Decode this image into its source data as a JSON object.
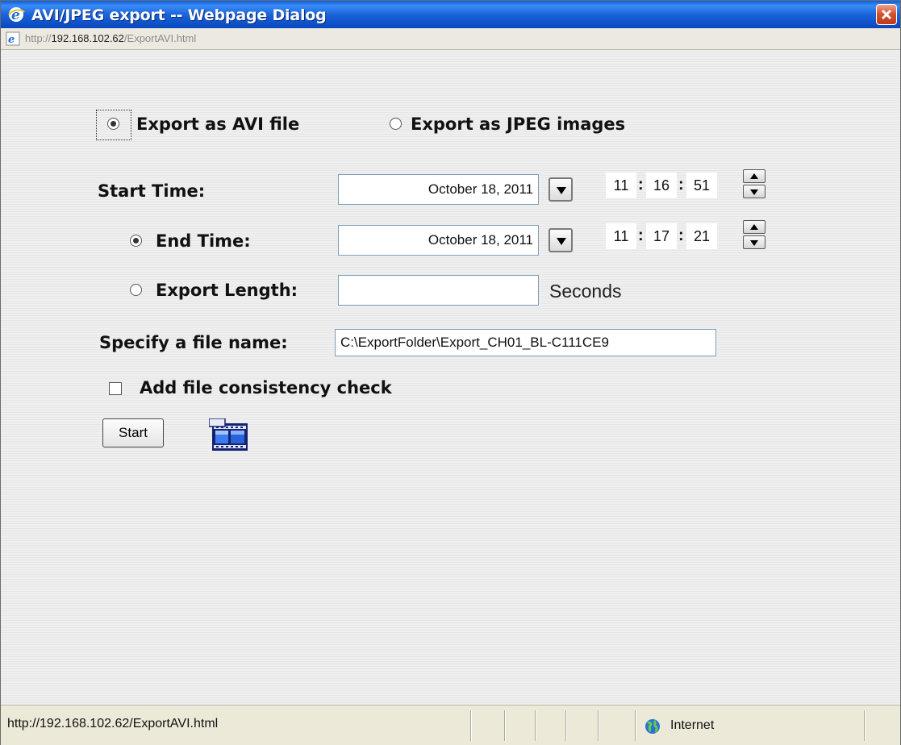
{
  "window": {
    "title": "AVI/JPEG export -- Webpage Dialog",
    "address_prefix": "http://",
    "address_host": "192.168.102.62",
    "address_path": "/ExportAVI.html"
  },
  "export_format": {
    "avi_label": "Export as AVI file",
    "jpeg_label": "Export as JPEG images",
    "selected": "avi"
  },
  "start_time": {
    "label": "Start Time:",
    "date": "October 18, 2011",
    "hour": "11",
    "minute": "16",
    "second": "51"
  },
  "end_time": {
    "label": "End Time:",
    "date": "October 18, 2011",
    "hour": "11",
    "minute": "17",
    "second": "21",
    "selected": true
  },
  "export_length": {
    "label": "Export Length:",
    "value": "",
    "unit": "Seconds",
    "selected": false
  },
  "file_name": {
    "label": "Specify a file name:",
    "value": "C:\\ExportFolder\\Export_CH01_BL-C111CE9"
  },
  "consistency_check": {
    "label": "Add file consistency check",
    "checked": false
  },
  "start_button": {
    "label": "Start"
  },
  "separators": {
    "colon": ":"
  },
  "status_bar": {
    "url": "http://192.168.102.62/ExportAVI.html",
    "zone": "Internet"
  },
  "colors": {
    "title_bar": "#1b63d8",
    "close_button": "#d24f2a",
    "field_border": "#7f9db9"
  },
  "icons": {
    "title": "ie-icon",
    "address": "ie-page-icon",
    "close": "close-icon",
    "film": "film-icon",
    "zone": "globe-icon"
  }
}
